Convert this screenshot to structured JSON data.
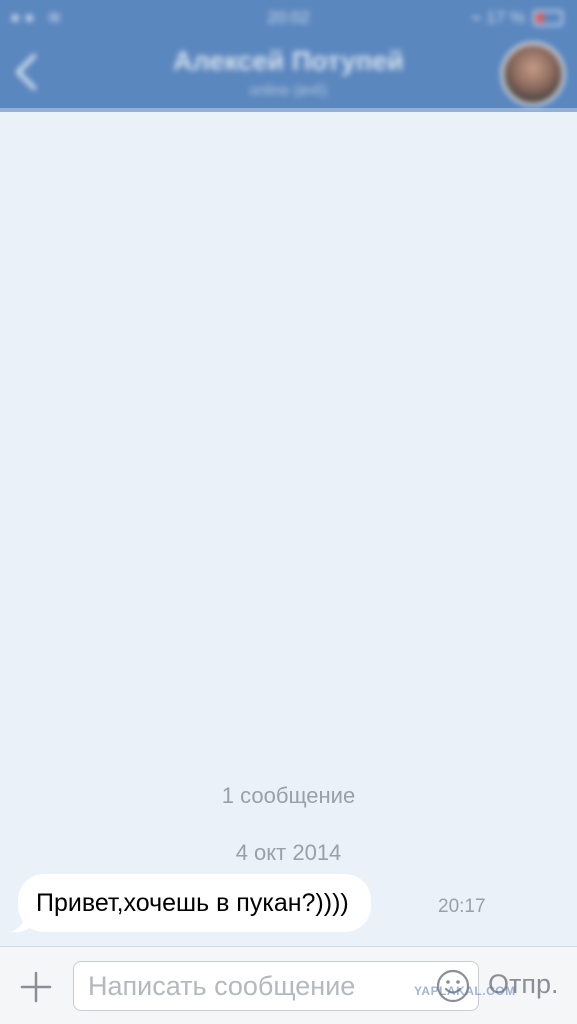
{
  "header": {
    "status_carrier": "●● ≋",
    "status_time": "20:02",
    "status_battery": "⌁ 17 %",
    "contact_name": "Алексей Потупей",
    "contact_status": "online (вчб)"
  },
  "chat": {
    "message_count": "1 сообщение",
    "date": "4 окт 2014",
    "messages": [
      {
        "text": "Привет,хочешь в пукан?))))",
        "time": "20:17",
        "direction": "incoming"
      }
    ]
  },
  "input_bar": {
    "placeholder": "Написать сообщение",
    "send_label": "Отпр."
  },
  "watermark": "YAPLAKAL.COM",
  "colors": {
    "header": "#5b87bf",
    "chat_background": "#ebf1f9",
    "bubble": "#ffffff",
    "meta_text": "#9aa0a8"
  },
  "icons": [
    "back-chevron-icon",
    "avatar",
    "plus-icon",
    "smiley-icon"
  ]
}
